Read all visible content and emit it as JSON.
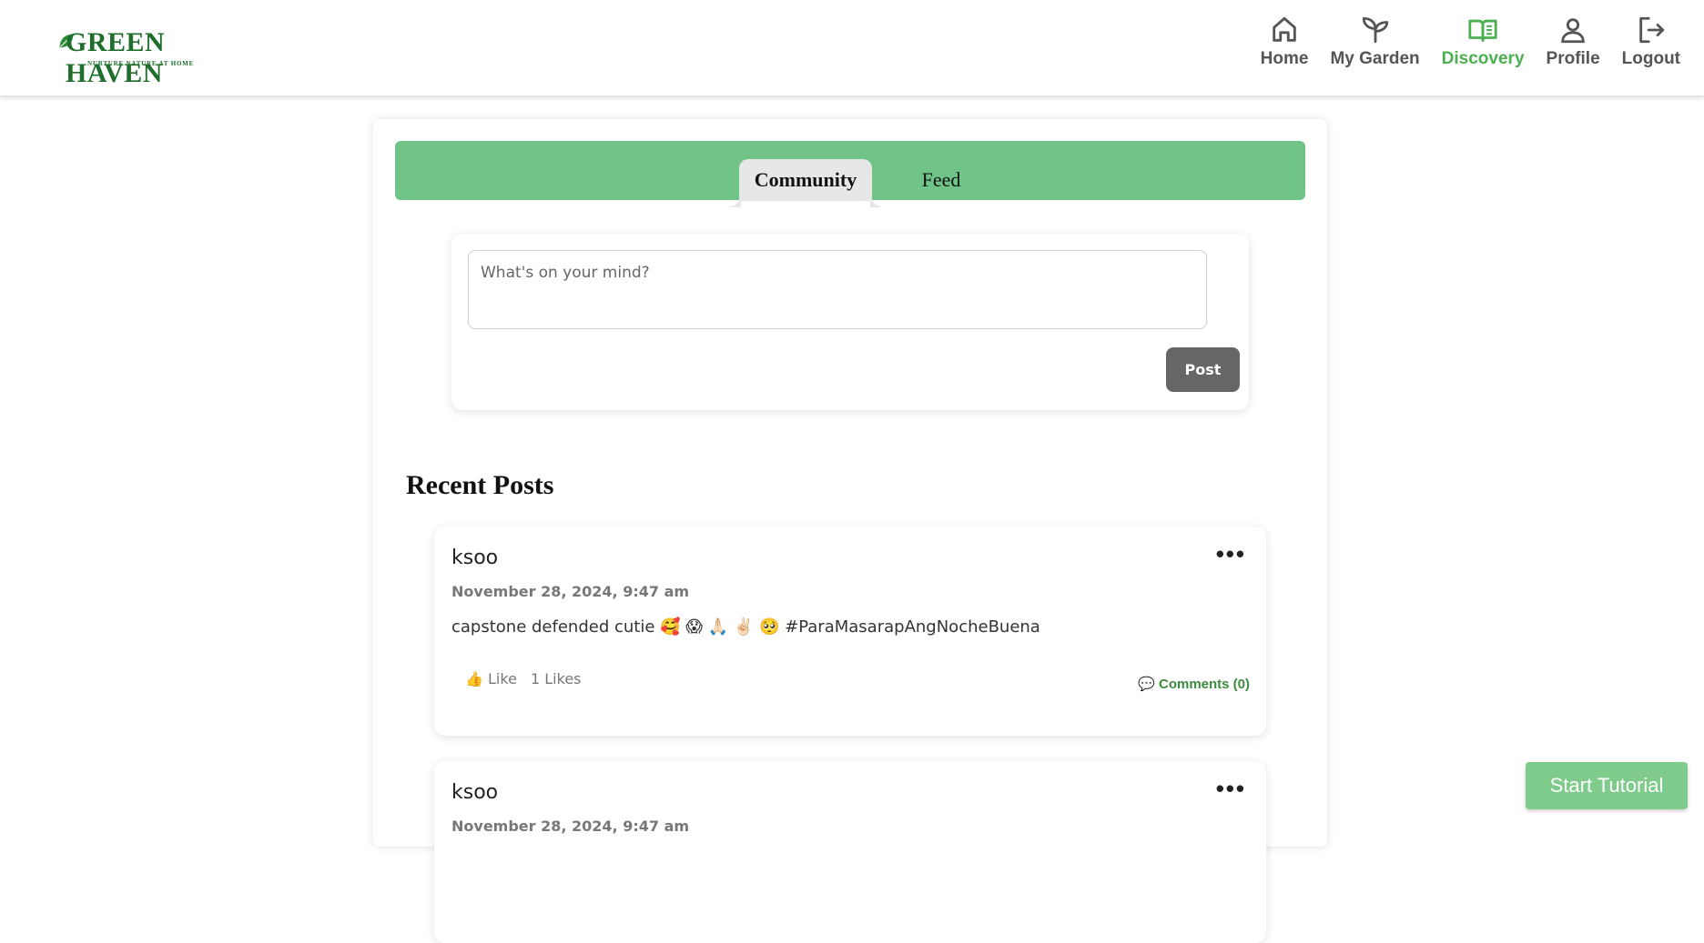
{
  "brand": {
    "name": "GREENHAVEN",
    "name_display": "GREEN HAVEN",
    "tagline": "NURTURE NATURE AT HOME",
    "accent_color": "#4caf50",
    "brand_green": "#1f6e2b"
  },
  "nav": {
    "items": [
      {
        "label": "Home",
        "icon": "home-icon",
        "active": false
      },
      {
        "label": "My Garden",
        "icon": "sprout-icon",
        "active": false
      },
      {
        "label": "Discovery",
        "icon": "book-open-icon",
        "active": true
      },
      {
        "label": "Profile",
        "icon": "user-icon",
        "active": false
      },
      {
        "label": "Logout",
        "icon": "logout-icon",
        "active": false
      }
    ]
  },
  "tabs": {
    "community": "Community",
    "feed": "Feed",
    "active": "Community",
    "bar_color": "#70c488"
  },
  "composer": {
    "placeholder": "What's on your mind?",
    "value": "",
    "post_label": "Post"
  },
  "recent": {
    "title": "Recent Posts",
    "posts": [
      {
        "author": "ksoo",
        "date": "November 28, 2024, 9:47 am",
        "body": "capstone defended cutie 🥰 😱 🙏🏻 ✌🏻 🥺 #ParaMasarapAngNocheBuena",
        "like_label": "👍 Like",
        "likes": "1 Likes",
        "comments": "💬 Comments (0)",
        "menu": "•••"
      },
      {
        "author": "ksoo",
        "date": "November 28, 2024, 9:47 am",
        "menu": "•••"
      }
    ]
  },
  "tutorial": {
    "label": "Start Tutorial",
    "color": "#7fcb8c"
  }
}
